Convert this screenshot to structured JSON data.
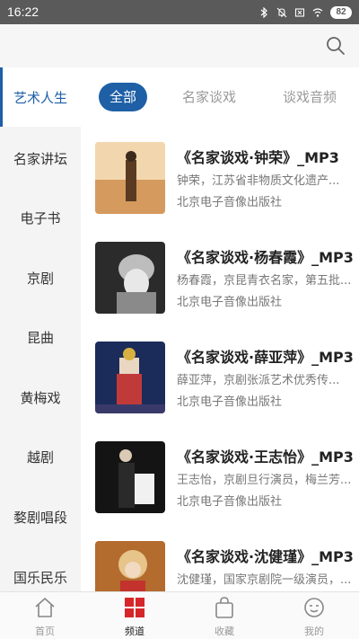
{
  "status_bar": {
    "time": "16:22",
    "battery": "82"
  },
  "sidebar": {
    "items": [
      {
        "label": "艺术人生"
      },
      {
        "label": "名家讲坛"
      },
      {
        "label": "电子书"
      },
      {
        "label": "京剧"
      },
      {
        "label": "昆曲"
      },
      {
        "label": "黄梅戏"
      },
      {
        "label": "越剧"
      },
      {
        "label": "婺剧唱段"
      },
      {
        "label": "国乐民乐"
      }
    ]
  },
  "tabs": [
    {
      "label": "全部"
    },
    {
      "label": "名家谈戏"
    },
    {
      "label": "谈戏音频"
    }
  ],
  "list": [
    {
      "title": "《名家谈戏·钟荣》_MP3",
      "desc": "钟荣，江苏省非物质文化遗产...",
      "publisher": "北京电子音像出版社"
    },
    {
      "title": "《名家谈戏·杨春霞》_MP3",
      "desc": "杨春霞，京昆青衣名家，第五批...",
      "publisher": "北京电子音像出版社"
    },
    {
      "title": "《名家谈戏·薛亚萍》_MP3",
      "desc": "薛亚萍，京剧张派艺术优秀传...",
      "publisher": "北京电子音像出版社"
    },
    {
      "title": "《名家谈戏·王志怡》_MP3",
      "desc": "王志怡，京剧旦行演员，梅兰芳...",
      "publisher": "北京电子音像出版社"
    },
    {
      "title": "《名家谈戏·沈健瑾》_MP3",
      "desc": "沈健瑾，国家京剧院一级演员，...",
      "publisher": ""
    }
  ],
  "bottom_nav": [
    {
      "label": "首页",
      "icon": "home-icon"
    },
    {
      "label": "频道",
      "icon": "channel-grid-icon"
    },
    {
      "label": "收藏",
      "icon": "bag-icon"
    },
    {
      "label": "我的",
      "icon": "profile-face-icon"
    }
  ],
  "colors": {
    "accent": "#1e5fa6",
    "channel_red": "#d6262a",
    "status_bar": "#5a5a5a"
  }
}
